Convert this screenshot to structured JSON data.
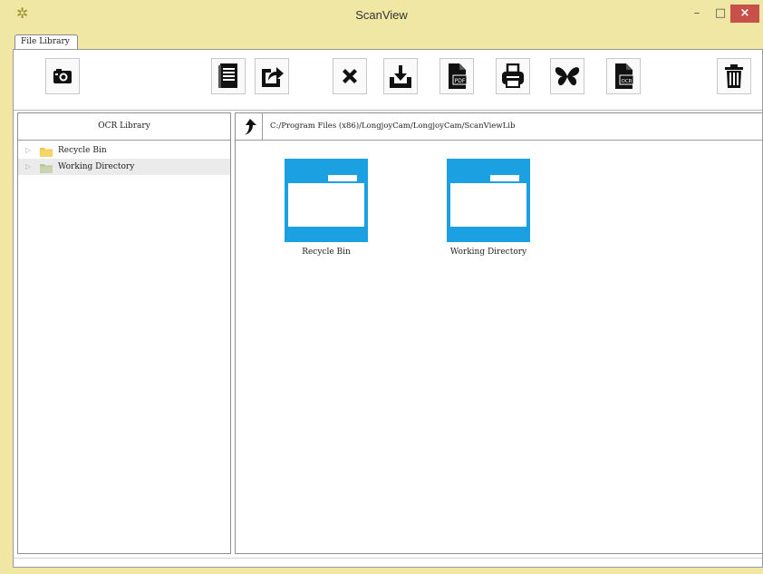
{
  "window": {
    "title": "ScanView",
    "app_icon": "gear-icon",
    "minimize": "–",
    "maximize": "□",
    "close": "×"
  },
  "tabs": [
    {
      "label": "File Library"
    }
  ],
  "toolbar": {
    "buttons": [
      {
        "name": "camera",
        "icon": "camera-icon"
      },
      {
        "name": "document-list",
        "icon": "document-list-icon"
      },
      {
        "name": "export",
        "icon": "export-icon"
      },
      {
        "name": "delete",
        "icon": "x-icon"
      },
      {
        "name": "import",
        "icon": "download-tray-icon"
      },
      {
        "name": "pdf",
        "icon": "pdf-file-icon"
      },
      {
        "name": "print",
        "icon": "printer-icon"
      },
      {
        "name": "butterfly",
        "icon": "butterfly-icon"
      },
      {
        "name": "ocr",
        "icon": "ocr-file-icon"
      },
      {
        "name": "trash",
        "icon": "trash-icon"
      }
    ]
  },
  "left_panel": {
    "header": "OCR Library",
    "tree": [
      {
        "label": "Recycle Bin",
        "selected": false
      },
      {
        "label": "Working Directory",
        "selected": true
      }
    ]
  },
  "right_panel": {
    "path": "C:/Program Files (x86)/LongjoyCam/LongjoyCam/ScanViewLib",
    "folders": [
      {
        "label": "Recycle Bin"
      },
      {
        "label": "Working Directory"
      }
    ]
  },
  "colors": {
    "folder_blue": "#1ba1e2",
    "title_bar": "#efe7a3",
    "close_red": "#c7504a"
  }
}
